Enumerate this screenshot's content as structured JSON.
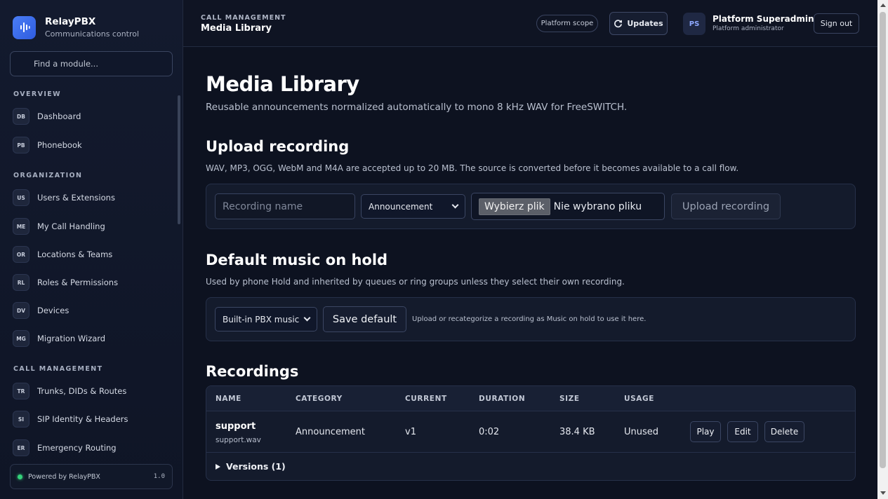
{
  "brand": {
    "name": "RelayPBX",
    "subtitle": "Communications control"
  },
  "search": {
    "placeholder": "Find a module..."
  },
  "sections": [
    {
      "title": "OVERVIEW",
      "items": [
        {
          "badge": "DB",
          "label": "Dashboard"
        },
        {
          "badge": "PB",
          "label": "Phonebook"
        }
      ]
    },
    {
      "title": "ORGANIZATION",
      "items": [
        {
          "badge": "US",
          "label": "Users & Extensions"
        },
        {
          "badge": "ME",
          "label": "My Call Handling"
        },
        {
          "badge": "OR",
          "label": "Locations & Teams"
        },
        {
          "badge": "RL",
          "label": "Roles & Permissions"
        },
        {
          "badge": "DV",
          "label": "Devices"
        },
        {
          "badge": "MG",
          "label": "Migration Wizard"
        }
      ]
    },
    {
      "title": "CALL MANAGEMENT",
      "items": [
        {
          "badge": "TR",
          "label": "Trunks, DIDs & Routes"
        },
        {
          "badge": "SI",
          "label": "SIP Identity & Headers"
        },
        {
          "badge": "ER",
          "label": "Emergency Routing"
        }
      ]
    }
  ],
  "footer": {
    "powered": "Powered by RelayPBX",
    "version": "1.0",
    "status_color": "#34d17a"
  },
  "topbar": {
    "section": "CALL MANAGEMENT",
    "title": "Media Library",
    "scope": "Platform scope",
    "updates": "Updates",
    "user_initials": "PS",
    "user_name": "Platform Superadmin",
    "user_role": "Platform administrator",
    "sign_out": "Sign out"
  },
  "page": {
    "title": "Media Library",
    "subtitle": "Reusable announcements normalized automatically to mono 8 kHz WAV for FreeSWITCH."
  },
  "upload": {
    "title": "Upload recording",
    "desc": "WAV, MP3, OGG, WebM and M4A are accepted up to 20 MB. The source is converted before it becomes available to a call flow.",
    "name_placeholder": "Recording name",
    "category_selected": "Announcement",
    "file_button": "Wybierz plik",
    "file_status": "Nie wybrano pliku",
    "submit": "Upload recording"
  },
  "moh": {
    "title": "Default music on hold",
    "desc": "Used by phone Hold and inherited by queues or ring groups unless they select their own recording.",
    "selected": "Built-in PBX music",
    "save": "Save default",
    "hint": "Upload or recategorize a recording as Music on hold to use it here."
  },
  "recordings": {
    "title": "Recordings",
    "columns": [
      "NAME",
      "CATEGORY",
      "CURRENT",
      "DURATION",
      "SIZE",
      "USAGE"
    ],
    "rows": [
      {
        "name": "support",
        "file": "support.wav",
        "category": "Announcement",
        "current": "v1",
        "duration": "0:02",
        "size": "38.4 KB",
        "usage": "Unused",
        "actions": [
          "Play",
          "Edit",
          "Delete"
        ]
      }
    ],
    "versions": "Versions (1)"
  },
  "colors": {
    "accent": "#4a7df5",
    "background": "#0d1220",
    "panel": "#141b2c"
  }
}
